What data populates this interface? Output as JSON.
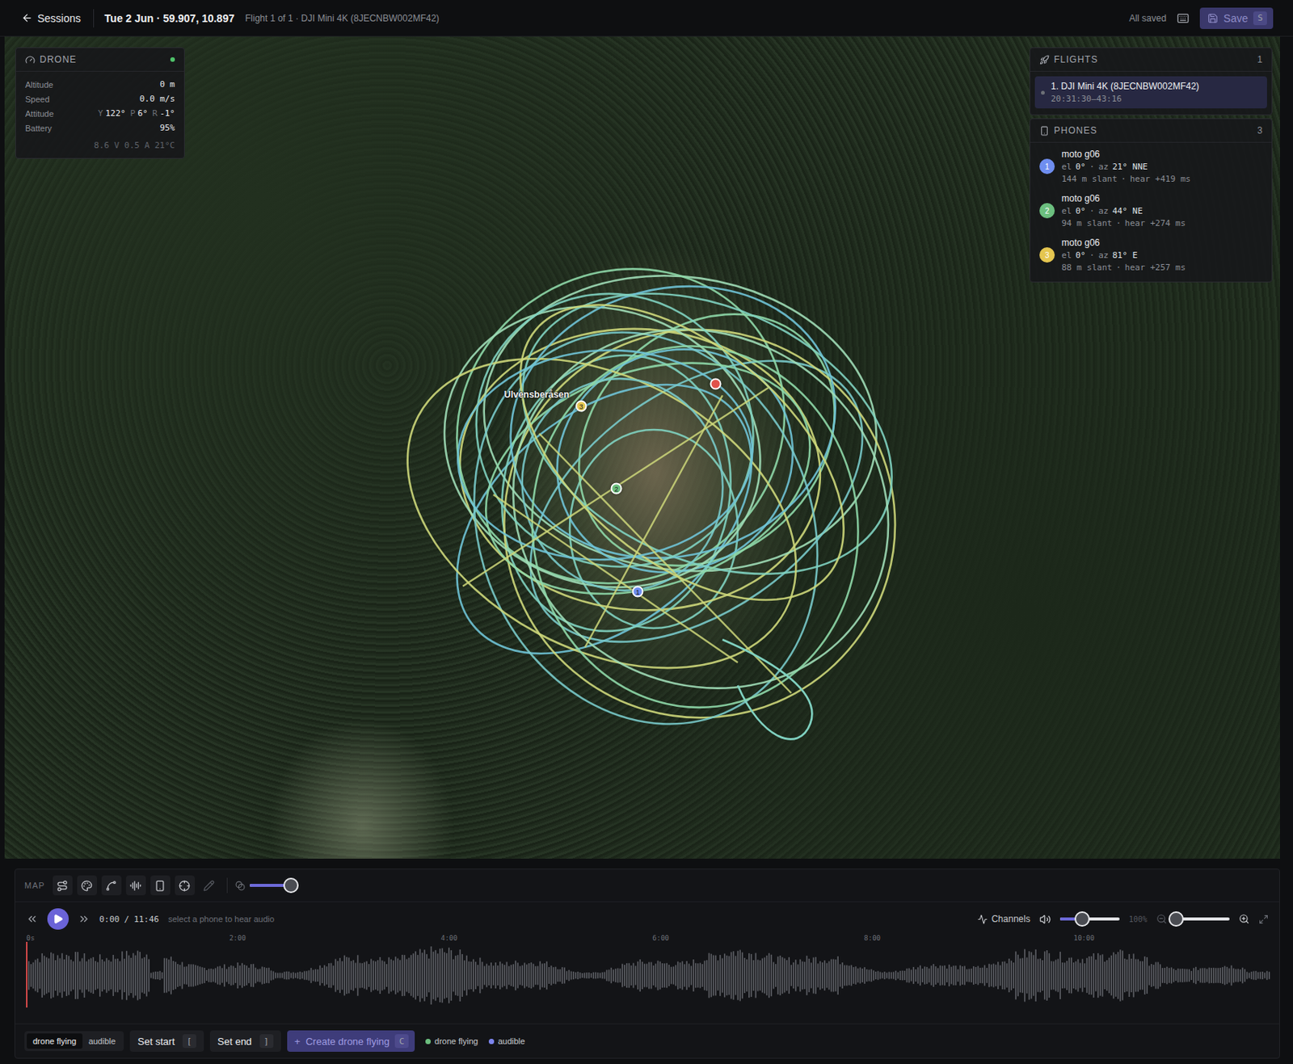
{
  "top_bar": {
    "back": "Sessions",
    "title": "Tue 2 Jun · 59.907, 10.897",
    "subtitle": "Flight 1 of 1 · DJI Mini 4K (8JECNBW002MF42)",
    "status": "All saved",
    "save": {
      "label": "Save",
      "key": "S",
      "disabled": true
    }
  },
  "drone_panel": {
    "title": "DRONE",
    "online": true,
    "rows": [
      {
        "label": "Altitude",
        "value": "0 m"
      },
      {
        "label": "Speed",
        "value": "0.0 m/s"
      },
      {
        "label": "Battery",
        "value": "95%"
      }
    ],
    "attitude": {
      "label": "Attitude",
      "axes": [
        {
          "axis": "Y",
          "value": "122°"
        },
        {
          "axis": "P",
          "value": "6°"
        },
        {
          "axis": "R",
          "value": "-1°"
        }
      ]
    },
    "footer": "8.6 V 0.5 A 21°C"
  },
  "flights_panel": {
    "title": "FLIGHTS",
    "count": "1",
    "items": [
      {
        "name": "1. DJI Mini 4K (8JECNBW002MF42)",
        "time": "20:31:30–43:16",
        "selected": true
      }
    ]
  },
  "phones_panel": {
    "title": "PHONES",
    "count": "3",
    "items": [
      {
        "number": "1",
        "color": "#6f8ef0",
        "name": "moto g06",
        "el_label": "el",
        "el": "0°",
        "sep": "·",
        "az_label": "az",
        "az": "21° NNE",
        "slant": "144 m slant",
        "hear": "hear +419 ms"
      },
      {
        "number": "2",
        "color": "#6cbf7f",
        "name": "moto g06",
        "el_label": "el",
        "el": "0°",
        "sep": "·",
        "az_label": "az",
        "az": "44° NE",
        "slant": "94 m slant",
        "hear": "hear +274 ms"
      },
      {
        "number": "3",
        "color": "#e5c650",
        "name": "moto g06",
        "el_label": "el",
        "el": "0°",
        "sep": "·",
        "az_label": "az",
        "az": "81° E",
        "slant": "88 m slant",
        "hear": "hear +257 ms"
      }
    ]
  },
  "map": {
    "place_label": "Ulvensberåsen",
    "drone_pin": {
      "color": "#e0524a"
    },
    "phone_pins": [
      {
        "number": "1",
        "color": "#6f8ef0"
      },
      {
        "number": "2",
        "color": "#6cbf7f"
      },
      {
        "number": "3",
        "color": "#e5c650"
      }
    ]
  },
  "toolbar": {
    "label": "MAP",
    "opacity_level": 1.0
  },
  "player": {
    "current": "0:00",
    "separator": "/",
    "total": "11:46",
    "hint": "select a phone to hear audio",
    "channels": "Channels",
    "volume_level": 0.37,
    "volume_reading": "100%",
    "zoom_level": 0.0,
    "playhead_level": 0.0
  },
  "timeline": {
    "ticks": [
      "0s",
      "2:00",
      "4:00",
      "6:00",
      "8:00",
      "10:00"
    ]
  },
  "bottom_bar": {
    "modes": [
      {
        "label": "drone flying",
        "selected": true
      },
      {
        "label": "audible",
        "selected": false
      }
    ],
    "set_start": {
      "label": "Set start",
      "key": "["
    },
    "set_end": {
      "label": "Set end",
      "key": "]"
    },
    "create": {
      "icon": "+",
      "label": "Create drone flying",
      "key": "C"
    },
    "legend": [
      {
        "label": "drone flying",
        "color": "#6cbf7f"
      },
      {
        "label": "audible",
        "color": "#7d86f0"
      }
    ]
  }
}
